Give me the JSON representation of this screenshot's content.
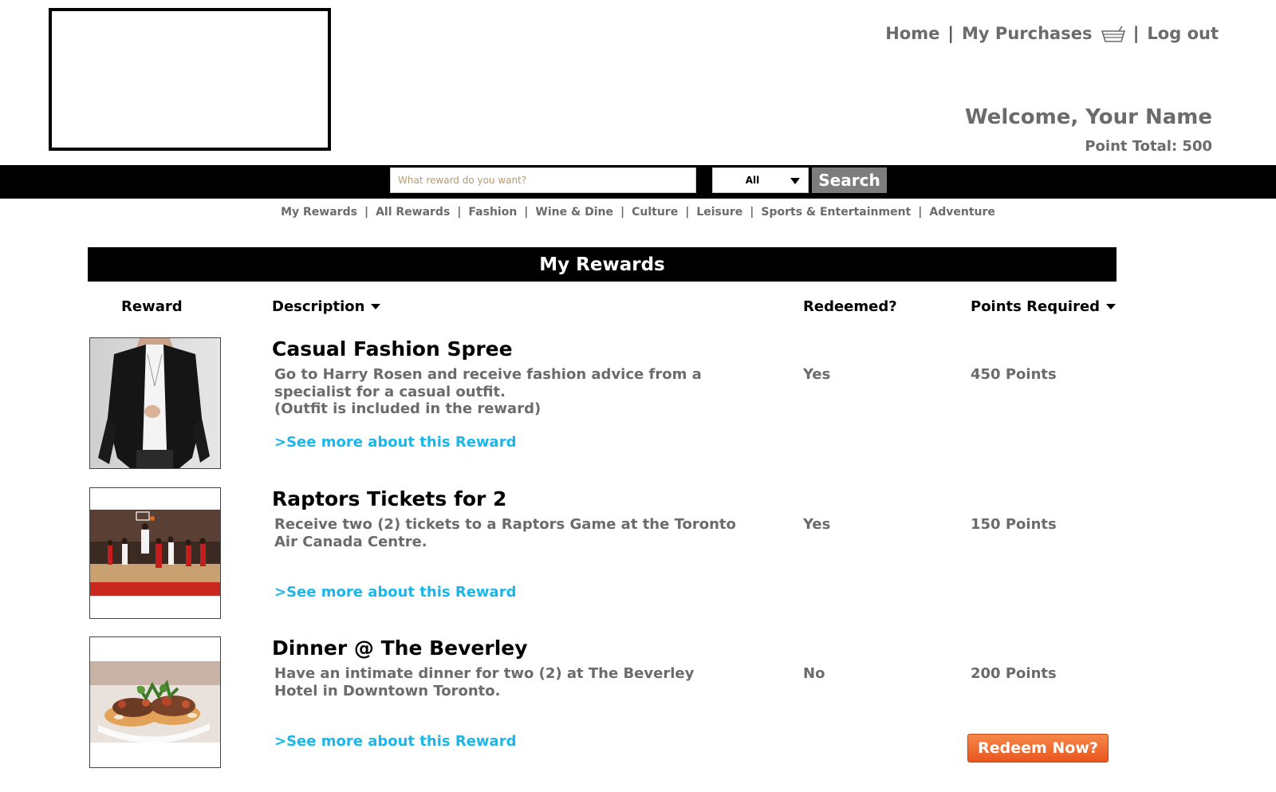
{
  "header": {
    "nav": {
      "home": "Home",
      "my_purchases": "My Purchases",
      "logout": "Log out",
      "separator": "|"
    },
    "welcome": "Welcome, Your Name",
    "point_total": "Point Total: 500"
  },
  "search": {
    "placeholder": "What reward do you want?",
    "value": "",
    "category_selected": "All",
    "button_label": "Search"
  },
  "categories": [
    "My Rewards",
    "All Rewards",
    "Fashion",
    "Wine & Dine",
    "Culture",
    "Leisure",
    "Sports & Entertainment",
    "Adventure"
  ],
  "section_title": "My Rewards",
  "columns": {
    "reward": "Reward",
    "description": "Description",
    "redeemed": "Redeemed?",
    "points": "Points Required"
  },
  "rewards": [
    {
      "title": "Casual Fashion Spree",
      "description": "Go to Harry Rosen and receive fashion advice from a\nspecialist for a casual outfit.\n(Outfit is included in the reward)",
      "link": ">See more about this Reward",
      "redeemed": "Yes",
      "points": "450 Points",
      "image": "fashion-photo"
    },
    {
      "title": "Raptors Tickets for 2",
      "description": "Receive two (2) tickets to a Raptors Game at the Toronto\nAir Canada Centre.",
      "link": ">See more about this Reward",
      "redeemed": "Yes",
      "points": "150 Points",
      "image": "basketball-photo"
    },
    {
      "title": "Dinner @ The Beverley",
      "description": "Have an intimate dinner for two (2) at The Beverley\nHotel in Downtown Toronto.",
      "link": ">See more about this Reward",
      "redeemed": "No",
      "points": "200 Points",
      "image": "dinner-photo",
      "action_label": "Redeem Now?"
    }
  ],
  "colors": {
    "link": "#1ab7ea",
    "muted_text": "#6b6b6b",
    "bar": "#000000",
    "redeem_button": "#e8561f",
    "search_button": "#7d7d7d"
  }
}
